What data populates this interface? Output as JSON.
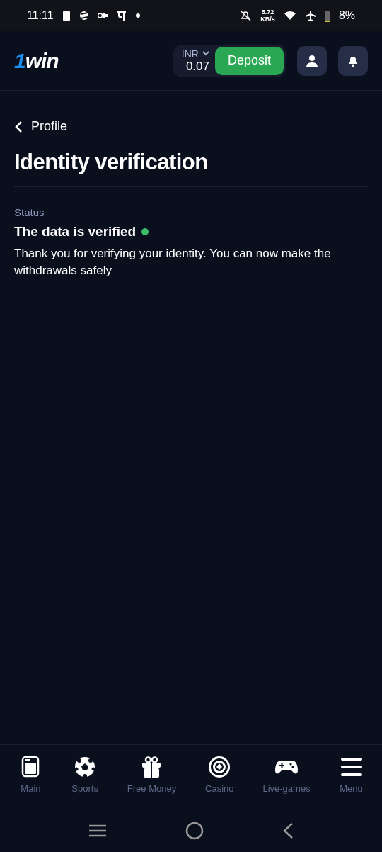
{
  "status_bar": {
    "time": "11:11",
    "speed_value": "5.72",
    "speed_unit": "KB/s",
    "battery": "8%"
  },
  "header": {
    "logo": {
      "mark": "1",
      "word": "win"
    },
    "balance": {
      "currency": "INR",
      "amount": "0.07"
    },
    "deposit_label": "Deposit"
  },
  "back_link": "Profile",
  "title": "Identity verification",
  "status": {
    "label": "Status",
    "value": "The data is verified",
    "color": "#3dbd6a",
    "message": "Thank you for verifying your identity. You can now make the withdrawals safely"
  },
  "bottom_nav": [
    {
      "kind": "main",
      "label": "Main",
      "selected": false
    },
    {
      "kind": "sports",
      "label": "Sports",
      "selected": false
    },
    {
      "kind": "gift",
      "label": "Free Money",
      "selected": false
    },
    {
      "kind": "casino",
      "label": "Casino",
      "selected": false
    },
    {
      "kind": "games",
      "label": "Live-games",
      "selected": false
    },
    {
      "kind": "menu",
      "label": "Menu",
      "selected": false
    }
  ]
}
